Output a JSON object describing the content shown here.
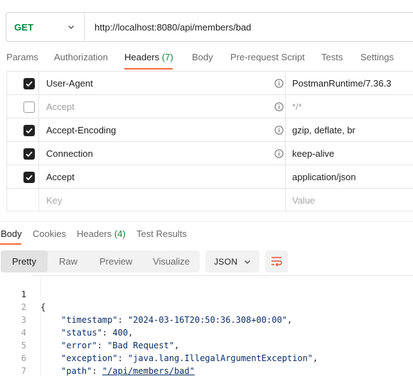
{
  "request": {
    "method": "GET",
    "url": "http://localhost:8080/api/members/bad"
  },
  "request_tabs": [
    {
      "label": "Params"
    },
    {
      "label": "Authorization"
    },
    {
      "label": "Headers",
      "count": "(7)"
    },
    {
      "label": "Body"
    },
    {
      "label": "Pre-request Script"
    },
    {
      "label": "Tests"
    },
    {
      "label": "Settings"
    }
  ],
  "headers": [
    {
      "key": "User-Agent",
      "value": "PostmanRuntime/7.36.3",
      "enabled": true,
      "info_icon": true
    },
    {
      "key": "Accept",
      "value": "*/*",
      "enabled": false,
      "info_icon": true
    },
    {
      "key": "Accept-Encoding",
      "value": "gzip, deflate, br",
      "enabled": true,
      "info_icon": true
    },
    {
      "key": "Connection",
      "value": "keep-alive",
      "enabled": true,
      "info_icon": true
    },
    {
      "key": "Accept",
      "value": "application/json",
      "enabled": true,
      "info_icon": false
    }
  ],
  "headers_placeholder": {
    "key": "Key",
    "value": "Value"
  },
  "response_tabs": [
    {
      "label": "Body"
    },
    {
      "label": "Cookies"
    },
    {
      "label": "Headers",
      "count": "(4)"
    },
    {
      "label": "Test Results"
    }
  ],
  "view_modes": [
    "Pretty",
    "Raw",
    "Preview",
    "Visualize"
  ],
  "selected_view_mode": "Pretty",
  "format": "JSON",
  "response_body": {
    "line_numbers": [
      "1",
      "2",
      "3",
      "4",
      "5",
      "6",
      "7"
    ],
    "open_brace": "{",
    "close_brace": "}",
    "fields": [
      {
        "key": "\"timestamp\"",
        "value": "\"2024-03-16T20:50:36.308+00:00\"",
        "type": "string"
      },
      {
        "key": "\"status\"",
        "value": "400",
        "type": "number"
      },
      {
        "key": "\"error\"",
        "value": "\"Bad Request\"",
        "type": "string"
      },
      {
        "key": "\"exception\"",
        "value": "\"java.lang.IllegalArgumentException\"",
        "type": "string"
      },
      {
        "key": "\"path\"",
        "value": "\"/api/members/bad\"",
        "type": "link"
      }
    ]
  },
  "colors": {
    "method_green": "#0b8a3e",
    "active_tab_underline": "#ff6c37",
    "wrap_icon": "#e8543a"
  }
}
